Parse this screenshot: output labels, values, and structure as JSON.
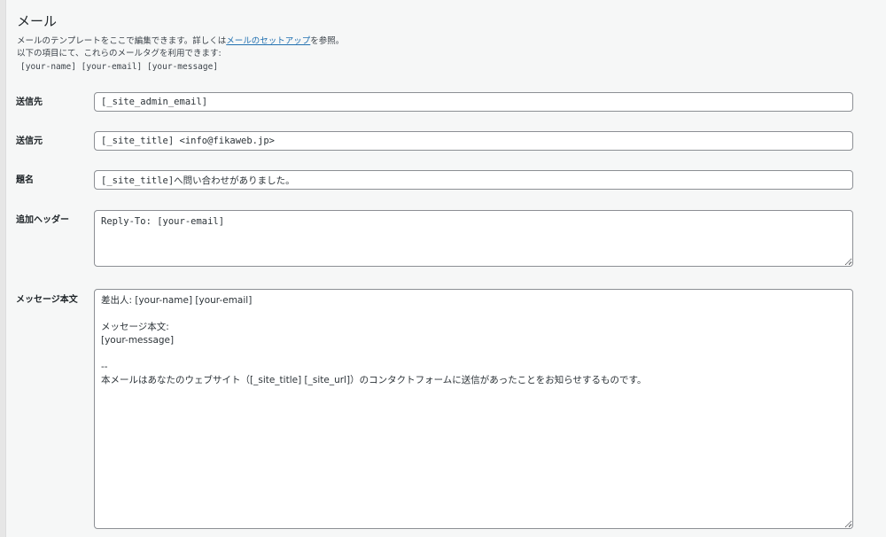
{
  "section": {
    "title": "メール",
    "desc_line1_prefix": "メールのテンプレートをここで編集できます。詳しくは",
    "desc_link": "メールのセットアップ",
    "desc_line1_suffix": "を参照。",
    "desc_line2": "以下の項目にて、これらのメールタグを利用できます:",
    "mail_tags": "[your-name] [your-email] [your-message]"
  },
  "fields": {
    "to": {
      "label": "送信先",
      "value": "[_site_admin_email]"
    },
    "from": {
      "label": "送信元",
      "value": "[_site_title] <info@fikaweb.jp>"
    },
    "subject": {
      "label": "題名",
      "value": "[_site_title]へ問い合わせがありました。"
    },
    "headers": {
      "label": "追加ヘッダー",
      "value": "Reply-To: [your-email]"
    },
    "body": {
      "label": "メッセージ本文",
      "value": "差出人: [your-name] [your-email]\n\nメッセージ本文:\n[your-message]\n\n--\n本メールはあなたのウェブサイト（[_site_title] [_site_url]）のコンタクトフォームに送信があったことをお知らせするものです。"
    }
  },
  "icons": {
    "resize": "resize-grip-icon"
  }
}
